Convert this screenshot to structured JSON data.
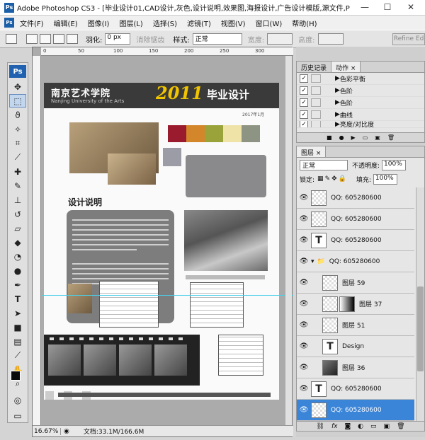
{
  "window": {
    "title": "Adobe Photoshop CS3 - [毕业设计01,CAD设计,灰色,设计说明,效果图,海报设计,广告设计模版,源文件,PS...",
    "app_badge": "Ps",
    "minimize": "—",
    "maximize": "☐",
    "close": "✕"
  },
  "menu": {
    "items": [
      "文件(F)",
      "编辑(E)",
      "图像(I)",
      "图层(L)",
      "选择(S)",
      "滤镜(T)",
      "视图(V)",
      "窗口(W)",
      "帮助(H)"
    ]
  },
  "options": {
    "feather_label": "羽化:",
    "feather_value": "0 px",
    "antialias_label": "消除锯齿",
    "style_label": "样式:",
    "style_value": "正常",
    "width_label": "宽度:",
    "height_label": "高度:",
    "refine_label": "Refine Ed"
  },
  "toolbar": {
    "badge": "Ps"
  },
  "document": {
    "ruler_numbers": [
      "0",
      "50",
      "100",
      "150",
      "200",
      "250",
      "300"
    ],
    "zoom": "16.67%",
    "doc_info": "文档:33.1M/166.6M"
  },
  "poster": {
    "title": "南京艺术学院",
    "subtitle": "Nanjing University of the Arts",
    "year": "2011",
    "headline": "毕业设计",
    "date": "2017年1月",
    "section_title": "设计说明",
    "palette": [
      "#9a1b2e",
      "#d3862a",
      "#9aa23a",
      "#f0e3a8",
      "#8e9484"
    ]
  },
  "history_panel": {
    "tabs": [
      "历史记录",
      "动作 ×"
    ],
    "actions": [
      "色彩平衡",
      "色阶",
      "色阶",
      "曲线",
      "亮度/对比度"
    ]
  },
  "layers_panel": {
    "tab": "图层 ×",
    "blend_mode": "正常",
    "opacity_label": "不透明度:",
    "opacity_value": "100%",
    "lock_label": "锁定:",
    "fill_label": "填充:",
    "fill_value": "100%",
    "layers": [
      {
        "name": "QQ: 605280600",
        "thumb": "",
        "indent": false,
        "selected": false
      },
      {
        "name": "QQ: 605280600",
        "thumb": "",
        "indent": false,
        "selected": false
      },
      {
        "name": "QQ: 605280600",
        "thumb": "T",
        "indent": false,
        "selected": false
      },
      {
        "name": "QQ: 605280600",
        "thumb": "",
        "indent": false,
        "selected": false
      },
      {
        "name": "图层 59",
        "thumb": "",
        "indent": true,
        "selected": false
      },
      {
        "name": "图层 37",
        "thumb": "",
        "indent": true,
        "selected": false
      },
      {
        "name": "图层 51",
        "thumb": "",
        "indent": true,
        "selected": false
      },
      {
        "name": "Design",
        "thumb": "T",
        "indent": true,
        "selected": false
      },
      {
        "name": "图层 36",
        "thumb": "",
        "indent": true,
        "selected": false
      },
      {
        "name": "QQ: 605280600",
        "thumb": "T",
        "indent": false,
        "selected": false
      },
      {
        "name": "QQ: 605280600",
        "thumb": "",
        "indent": false,
        "selected": true
      }
    ],
    "footer_icons": [
      "link-icon",
      "fx-icon",
      "mask-icon",
      "adjust-icon",
      "folder-icon",
      "new-layer-icon",
      "trash-icon"
    ]
  }
}
